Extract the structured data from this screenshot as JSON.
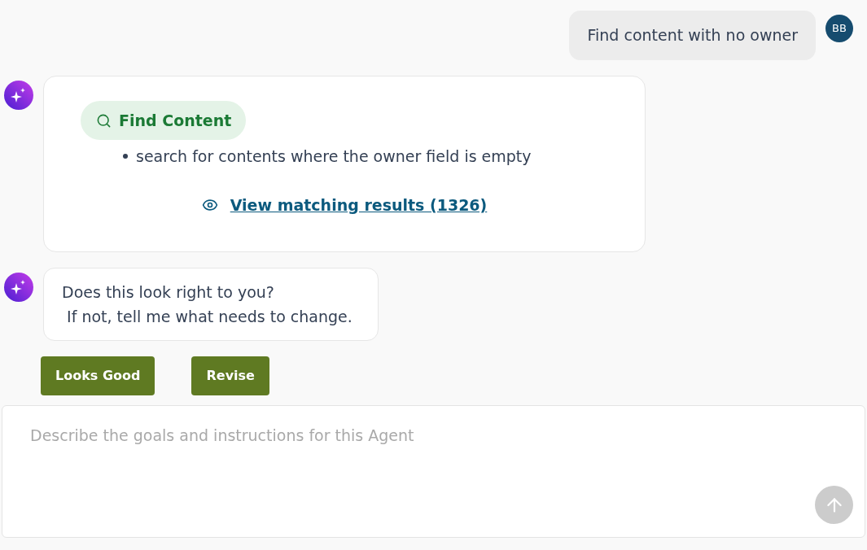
{
  "user_message": {
    "avatar": "BB",
    "text": "Find content with no owner"
  },
  "agent_messages": [
    {
      "kind": "action",
      "action": {
        "label": "Find Content"
      },
      "bullets": [
        "search for contents where the owner field is empty"
      ],
      "link": "View matching results (1326)"
    },
    {
      "kind": "text",
      "text": "Does this look right to you?\n If not, tell me what needs to change."
    }
  ],
  "reply_buttons": [
    "Looks Good",
    "Revise"
  ],
  "composer": {
    "placeholder": "Describe the goals and instructions for this Agent",
    "send_button": {
      "disabled": true
    }
  }
}
